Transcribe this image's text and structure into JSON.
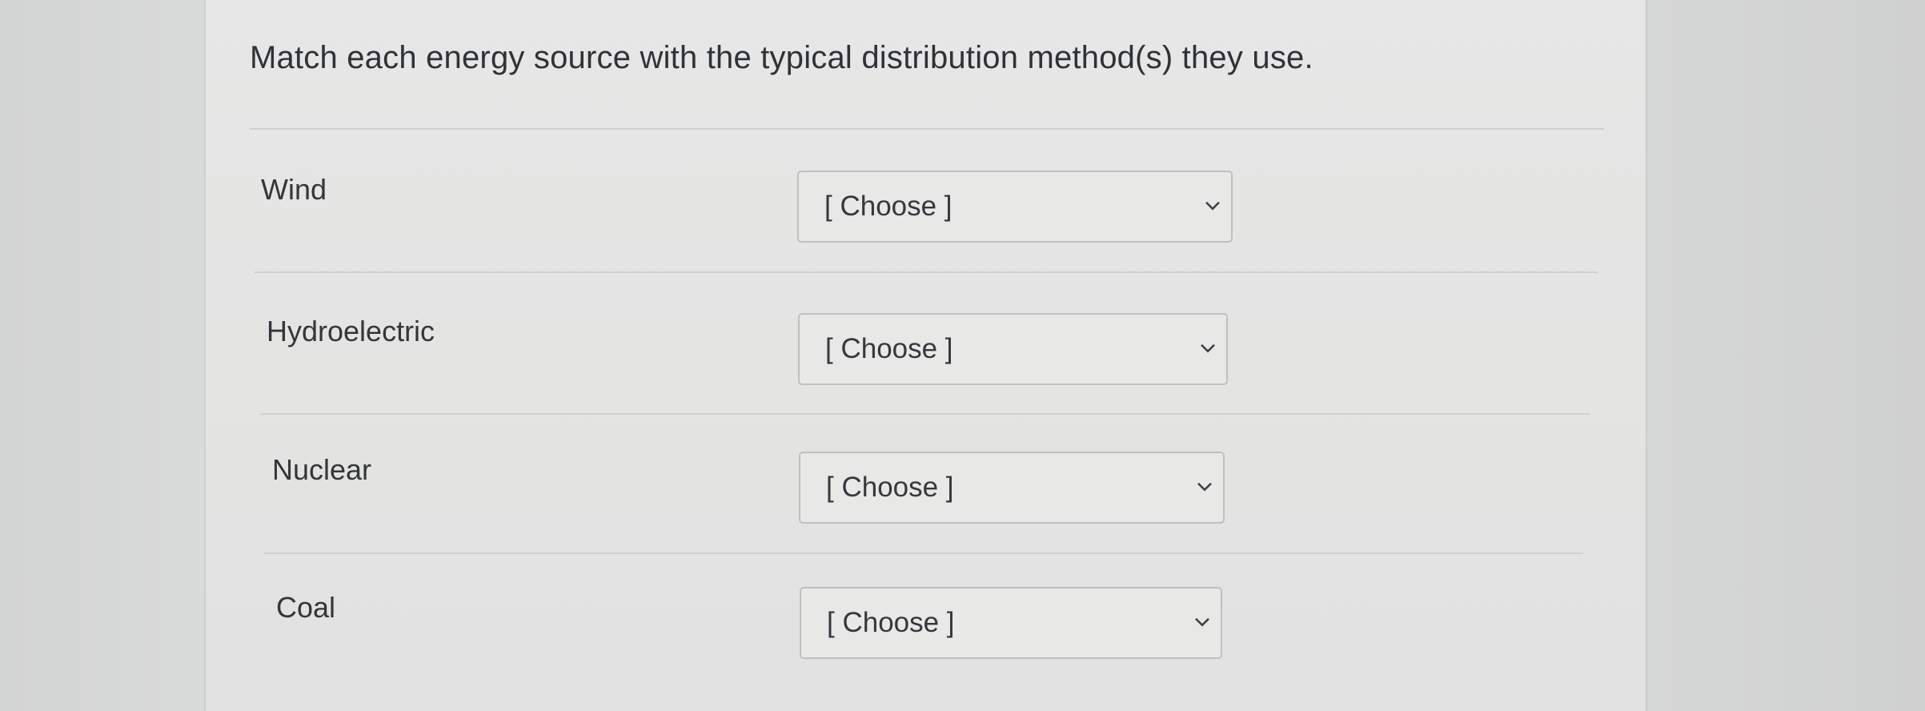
{
  "question": {
    "text": "Match each energy source with the typical distribution method(s) they use."
  },
  "rows": [
    {
      "label": "Wind",
      "selected": "[ Choose ]"
    },
    {
      "label": "Hydroelectric",
      "selected": "[ Choose ]"
    },
    {
      "label": "Nuclear",
      "selected": "[ Choose ]"
    },
    {
      "label": "Coal",
      "selected": "[ Choose ]"
    }
  ],
  "icons": {
    "dropdown": "chevron-down-icon"
  },
  "colors": {
    "panel_background": "#e4e4e3",
    "text": "#2f3236",
    "select_border": "#bfc0bf"
  }
}
